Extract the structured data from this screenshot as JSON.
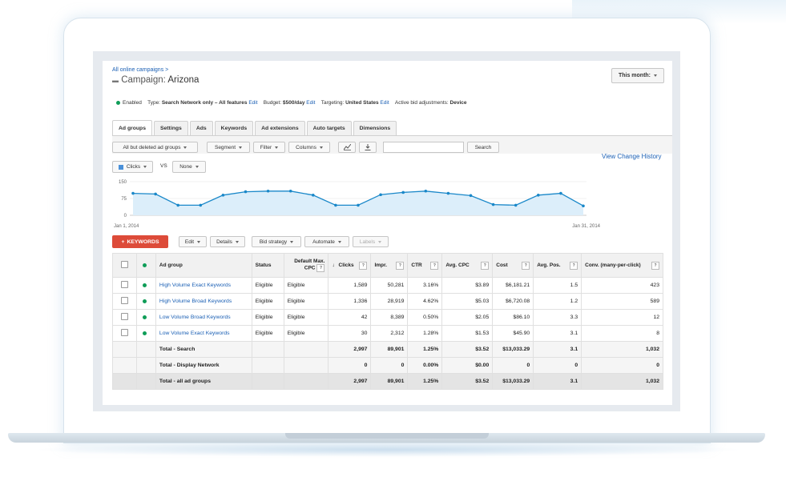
{
  "breadcrumb": "All online campaigns >",
  "campaign": {
    "label": "Campaign:",
    "name": "Arizona"
  },
  "date_range": "This month:",
  "status": {
    "enabled": "Enabled",
    "type_label": "Type:",
    "type_value": "Search Network only – All features",
    "edit1": "Edit",
    "budget_label": "Budget:",
    "budget_value": "$500/day",
    "edit2": "Edit",
    "targeting_label": "Targeting:",
    "targeting_value": "United States",
    "edit3": "Edit",
    "bid_label": "Active bid adjustments:",
    "bid_value": "Device"
  },
  "tabs": [
    "Ad groups",
    "Settings",
    "Ads",
    "Keywords",
    "Ad extensions",
    "Auto targets",
    "Dimensions"
  ],
  "toolbar": {
    "filter_select": "All but deleted ad groups",
    "segment": "Segment",
    "filter": "Filter",
    "columns": "Columns",
    "search": "Search"
  },
  "view_history": "View Change History",
  "metric1": "Clicks",
  "vs": "VS",
  "metric2": "None",
  "chart_data": {
    "type": "line",
    "x_start_label": "Jan 1, 2014",
    "x_end_label": "Jan 31, 2014",
    "yticks": [
      "150",
      "75",
      "0"
    ],
    "ylim": [
      0,
      150
    ],
    "series": [
      {
        "name": "Clicks",
        "values": [
          98,
          95,
          45,
          45,
          90,
          105,
          108,
          108,
          90,
          45,
          45,
          92,
          102,
          108,
          98,
          88,
          48,
          45,
          90,
          98,
          42
        ]
      }
    ],
    "color": "#1a88c9"
  },
  "actions": {
    "keywords": "KEYWORDS",
    "edit": "Edit",
    "details": "Details",
    "bid_strategy": "Bid strategy",
    "automate": "Automate",
    "labels": "Labels"
  },
  "table": {
    "headers": [
      "Ad group",
      "Status",
      "Default Max. CPC",
      "Clicks",
      "Impr.",
      "CTR",
      "Avg. CPC",
      "Cost",
      "Avg. Pos.",
      "Conv. (many-per-click)"
    ],
    "rows": [
      {
        "name": "High Volume Exact Keywords",
        "status": "Eligible",
        "cpc": "Eligible",
        "clicks": "1,589",
        "impr": "50,281",
        "ctr": "3.16%",
        "avgcpc": "$3.89",
        "cost": "$6,181.21",
        "pos": "1.5",
        "conv": "423"
      },
      {
        "name": "High Volume Broad Keywords",
        "status": "Eligible",
        "cpc": "Eligible",
        "clicks": "1,336",
        "impr": "28,919",
        "ctr": "4.62%",
        "avgcpc": "$5.03",
        "cost": "$6,720.08",
        "pos": "1.2",
        "conv": "589"
      },
      {
        "name": "Low Volume Broad Keywords",
        "status": "Eligible",
        "cpc": "Eligible",
        "clicks": "42",
        "impr": "8,389",
        "ctr": "0.50%",
        "avgcpc": "$2.05",
        "cost": "$86.10",
        "pos": "3.3",
        "conv": "12"
      },
      {
        "name": "Low Volume Exact Keywords",
        "status": "Eligible",
        "cpc": "Eligible",
        "clicks": "30",
        "impr": "2,312",
        "ctr": "1.28%",
        "avgcpc": "$1.53",
        "cost": "$45.90",
        "pos": "3.1",
        "conv": "8"
      }
    ],
    "totals": [
      {
        "name": "Total - Search",
        "clicks": "2,997",
        "impr": "89,901",
        "ctr": "1.25%",
        "avgcpc": "$3.52",
        "cost": "$13,033.29",
        "pos": "3.1",
        "conv": "1,032"
      },
      {
        "name": "Total - Display Network",
        "clicks": "0",
        "impr": "0",
        "ctr": "0.00%",
        "avgcpc": "$0.00",
        "cost": "0",
        "pos": "0",
        "conv": "0"
      },
      {
        "name": "Total - all ad groups",
        "clicks": "2,997",
        "impr": "89,901",
        "ctr": "1.25%",
        "avgcpc": "$3.52",
        "cost": "$13,033.29",
        "pos": "3.1",
        "conv": "1,032"
      }
    ]
  }
}
